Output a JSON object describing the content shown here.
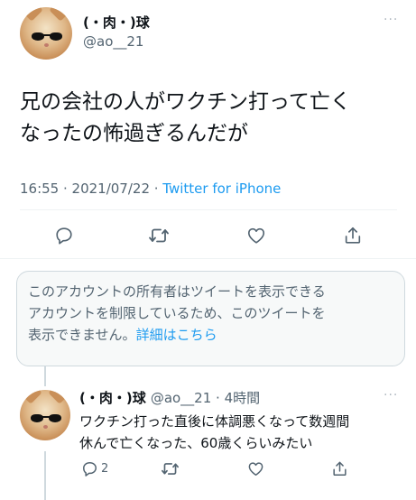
{
  "main_tweet": {
    "display_name": "(・肉・)球",
    "handle": "@ao__21",
    "more": "···",
    "text_line1": "兄の会社の人がワクチン打って亡く",
    "text_line2": "なったの怖過ぎるんだが",
    "timestamp": "16:55 · 2021/07/22 · ",
    "source": "Twitter for iPhone"
  },
  "notice": {
    "line1": "このアカウントの所有者はツイートを表示できる",
    "line2": "アカウントを制限しているため、このツイートを",
    "line3": "表示できません。",
    "link": "詳細はこちら"
  },
  "reply": {
    "display_name": "(・肉・)球",
    "handle_time": "@ao__21 · 4時間",
    "more": "···",
    "text_line1": "ワクチン打った直後に体調悪くなって数週間",
    "text_line2": "休んで亡くなった、60歳くらいみたい",
    "reply_count": "2"
  },
  "icons": {
    "reply": "reply-icon",
    "retweet": "retweet-icon",
    "like": "like-icon",
    "share": "share-icon"
  },
  "colors": {
    "link": "#1d9bf0",
    "muted": "#536471",
    "text": "#0f1419"
  }
}
